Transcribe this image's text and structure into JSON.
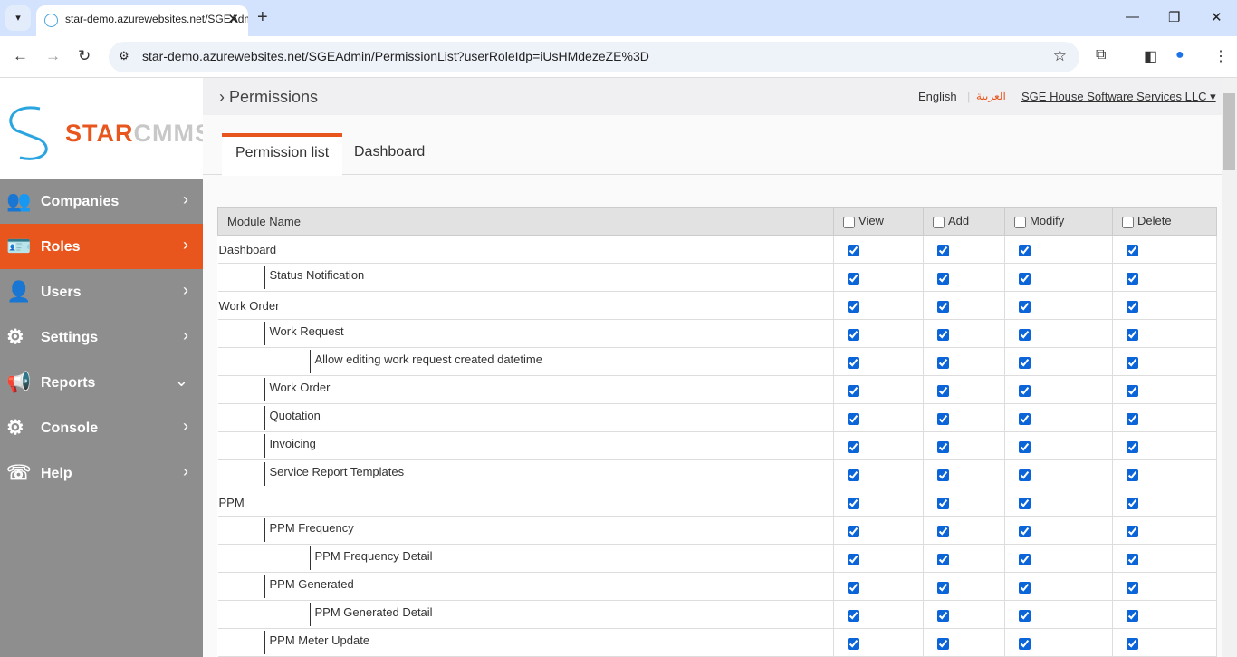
{
  "browser": {
    "tab_title": "star-demo.azurewebsites.net/SGEAdmin",
    "url": "star-demo.azurewebsites.net/SGEAdmin/PermissionList?userRoleIdp=iUsHMdezeZE%3D"
  },
  "logo": {
    "part1": "STAR",
    "part2": "CMMS"
  },
  "sidebar": {
    "items": [
      {
        "label": "Companies",
        "icon": "users-group-icon",
        "chevron": "›"
      },
      {
        "label": "Roles",
        "icon": "id-card-icon",
        "chevron": "›",
        "active": true
      },
      {
        "label": "Users",
        "icon": "user-icon",
        "chevron": "›"
      },
      {
        "label": "Settings",
        "icon": "gear-icon",
        "chevron": "›"
      },
      {
        "label": "Reports",
        "icon": "megaphone-icon",
        "chevron": "⌄"
      },
      {
        "label": "Console",
        "icon": "gear-icon",
        "chevron": "›"
      },
      {
        "label": "Help",
        "icon": "phone-icon",
        "chevron": "›"
      }
    ]
  },
  "header": {
    "breadcrumb": "Permissions",
    "lang_en": "English",
    "lang_ar": "العربية",
    "company": "SGE House Software Services LLC"
  },
  "tabs": [
    "Permission list",
    "Dashboard"
  ],
  "table": {
    "headers": [
      "Module Name",
      "View",
      "Add",
      "Modify",
      "Delete"
    ],
    "rows": [
      {
        "name": "Dashboard",
        "level": 0
      },
      {
        "name": "Status Notification",
        "level": 1
      },
      {
        "name": "Work Order",
        "level": 0
      },
      {
        "name": "Work Request",
        "level": 1
      },
      {
        "name": "Allow editing work request created datetime",
        "level": 2
      },
      {
        "name": "Work Order",
        "level": 1
      },
      {
        "name": "Quotation",
        "level": 1
      },
      {
        "name": "Invoicing",
        "level": 1
      },
      {
        "name": "Service Report Templates",
        "level": 1
      },
      {
        "name": "PPM",
        "level": 0
      },
      {
        "name": "PPM Frequency",
        "level": 1
      },
      {
        "name": "PPM Frequency Detail",
        "level": 2
      },
      {
        "name": "PPM Generated",
        "level": 1
      },
      {
        "name": "PPM Generated Detail",
        "level": 2
      },
      {
        "name": "PPM Meter Update",
        "level": 1
      }
    ]
  },
  "colors": {
    "accent": "#e8561e",
    "sidebar": "#8e8e8e",
    "checkbox": "#0b65d8"
  }
}
